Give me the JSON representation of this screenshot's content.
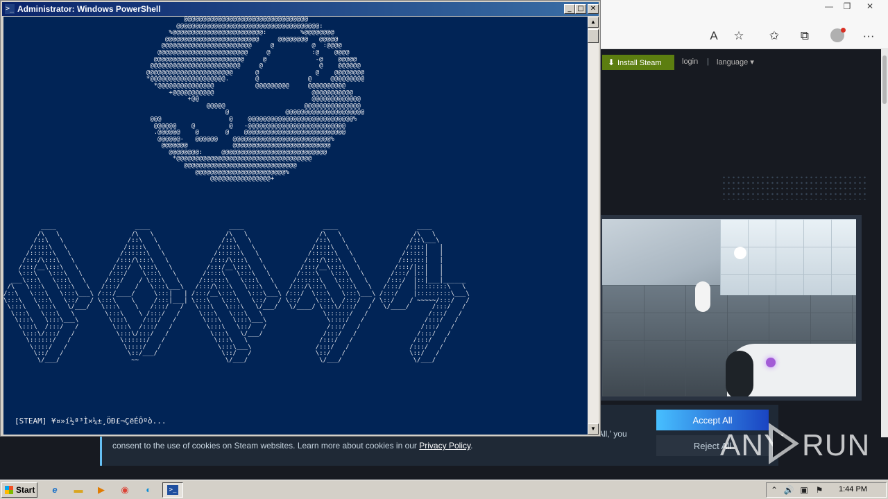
{
  "browser": {
    "window_controls": {
      "minimize": "—",
      "restore": "❐",
      "close": "✕"
    },
    "toolbar_icons": [
      "read-aloud",
      "add-favorite",
      "favorites",
      "collections",
      "profile",
      "more"
    ],
    "toolbar_glyphs": {
      "read_aloud": "A",
      "add_favorite": "☆",
      "favorites": "✩",
      "collections": "⧉",
      "more": "···"
    }
  },
  "steam": {
    "install_label": "Install Steam",
    "login_label": "login",
    "separator": "|",
    "language_label": "language ▾"
  },
  "cookie": {
    "text_1": "All,' you",
    "text_2_prefix": "consent to the use of cookies on Steam websites. Learn more about cookies in our ",
    "privacy_link": "Privacy Policy",
    "text_2_suffix": ".",
    "accept_label": "Accept All",
    "reject_label": "Reject All"
  },
  "watermark": {
    "left": "ANY",
    "right": "RUN"
  },
  "powershell": {
    "title": "Administrator: Windows PowerShell",
    "icon_glyph": ">_",
    "controls": {
      "minimize": "_",
      "maximize": "□",
      "close": "✕"
    },
    "status_line": "[STEAM] ¥¤»í½ª³Ì×¼±¸ÖÐ£¬ÇëÉÔºò...",
    "scroll_up": "▲",
    "scroll_down": "▼"
  },
  "taskbar": {
    "start_label": "Start",
    "apps": [
      "internet-explorer",
      "file-explorer",
      "media-player",
      "chrome",
      "edge",
      "powershell"
    ],
    "app_glyphs": {
      "ie": "e",
      "explorer": "▬",
      "media": "▶",
      "chrome": "◉",
      "edge": "◐"
    },
    "clock": "1:44 PM",
    "tray_glyphs": {
      "show_hidden": "⌃",
      "volume": "🔊",
      "network": "▣",
      "flag": "⚑"
    }
  },
  "colors": {
    "console_bg": "#012456",
    "steam_green": "#5c7e10",
    "accept_gradient_start": "#47bfff",
    "accept_gradient_end": "#1a44c2",
    "titlebar_start": "#0a246a"
  }
}
